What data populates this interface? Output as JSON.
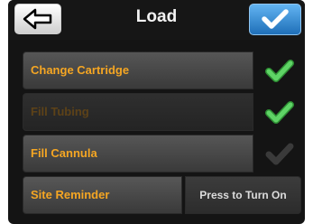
{
  "header": {
    "title": "Load",
    "back_icon": "arrow-left-icon",
    "confirm_icon": "checkmark-icon"
  },
  "rows": [
    {
      "label": "Change Cartridge",
      "enabled": true,
      "status": "completed",
      "status_icon": "green-checkmark-icon"
    },
    {
      "label": "Fill Tubing",
      "enabled": false,
      "status": "completed",
      "status_icon": "green-checkmark-icon"
    },
    {
      "label": "Fill Cannula",
      "enabled": true,
      "status": "pending",
      "status_icon": "gray-checkmark-icon"
    }
  ],
  "site_reminder": {
    "label": "Site Reminder",
    "toggle_label": "Press to Turn On"
  },
  "colors": {
    "accent_label": "#f5a623",
    "confirm_blue": "#1f6fb8",
    "check_green": "#4cc653",
    "check_gray": "#3a3a3a"
  }
}
